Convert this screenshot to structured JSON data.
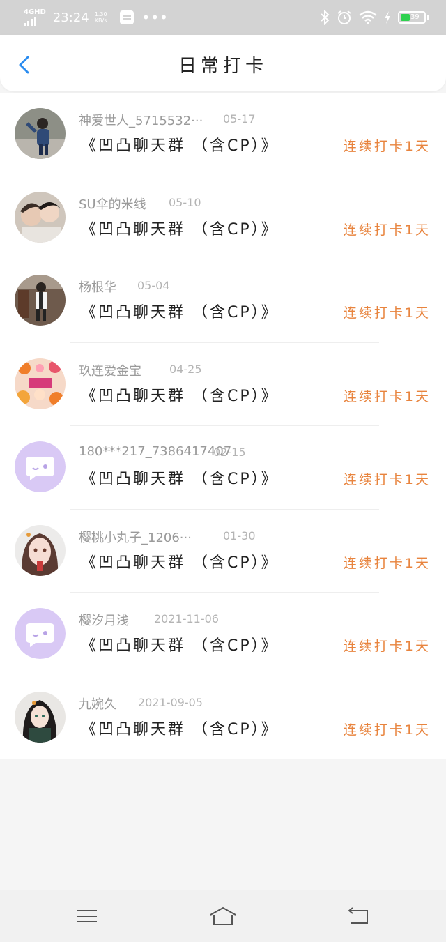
{
  "status_bar": {
    "network": "4GHD",
    "time": "23:24",
    "speed_value": "1.30",
    "speed_unit": "KB/s",
    "dots": "•••",
    "battery": "39"
  },
  "header": {
    "title": "日常打卡"
  },
  "group_name": "《凹凸聊天群 （含CP）》",
  "streak_label": "连续打卡1天",
  "entries": [
    {
      "user": "神爱世人_5715532···",
      "date": "05-17"
    },
    {
      "user": "SU伞的米线",
      "date": "05-10"
    },
    {
      "user": "杨根华",
      "date": "05-04"
    },
    {
      "user": "玖连爱金宝",
      "date": "04-25"
    },
    {
      "user": "180***217_7386417407",
      "date": "02-15"
    },
    {
      "user": "樱桃小丸子_1206···",
      "date": "01-30"
    },
    {
      "user": "樱汐月浅",
      "date": "2021-11-06"
    },
    {
      "user": "九婉久",
      "date": "2021-09-05"
    }
  ],
  "colors": {
    "accent": "#2a8cf0",
    "streak": "#e8843e",
    "default_avatar": "#d9c9f5"
  }
}
